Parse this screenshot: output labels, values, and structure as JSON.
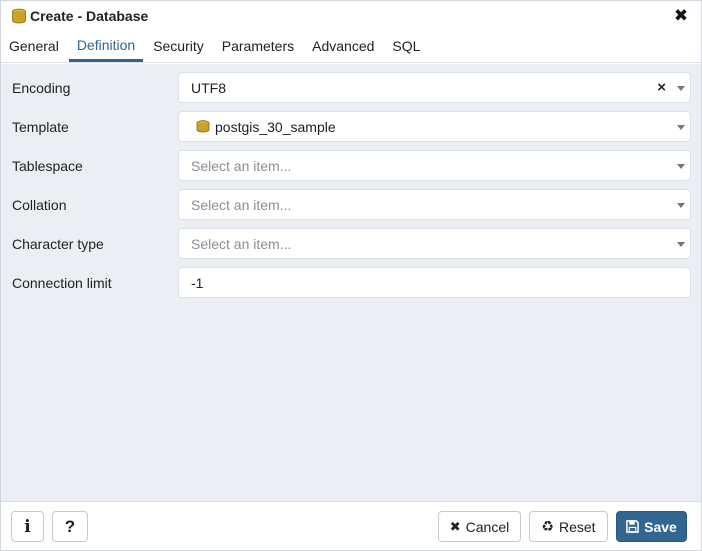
{
  "window": {
    "title": "Create - Database",
    "title_icon": "database-icon",
    "close_icon": "close-icon"
  },
  "tabs": [
    {
      "label": "General",
      "active": false
    },
    {
      "label": "Definition",
      "active": true
    },
    {
      "label": "Security",
      "active": false
    },
    {
      "label": "Parameters",
      "active": false
    },
    {
      "label": "Advanced",
      "active": false
    },
    {
      "label": "SQL",
      "active": false
    }
  ],
  "form": {
    "encoding": {
      "label": "Encoding",
      "value": "UTF8"
    },
    "template": {
      "label": "Template",
      "value": "postgis_30_sample",
      "icon": "database-icon"
    },
    "tablespace": {
      "label": "Tablespace",
      "placeholder": "Select an item..."
    },
    "collation": {
      "label": "Collation",
      "placeholder": "Select an item..."
    },
    "character_type": {
      "label": "Character type",
      "placeholder": "Select an item..."
    },
    "connection_limit": {
      "label": "Connection limit",
      "value": "-1"
    }
  },
  "footer": {
    "info_label": "i",
    "help_label": "?",
    "cancel_label": "Cancel",
    "reset_label": "Reset",
    "save_label": "Save"
  },
  "colors": {
    "accent": "#326690",
    "body_bg": "#ebeef3",
    "db_icon": "#c9a227"
  }
}
